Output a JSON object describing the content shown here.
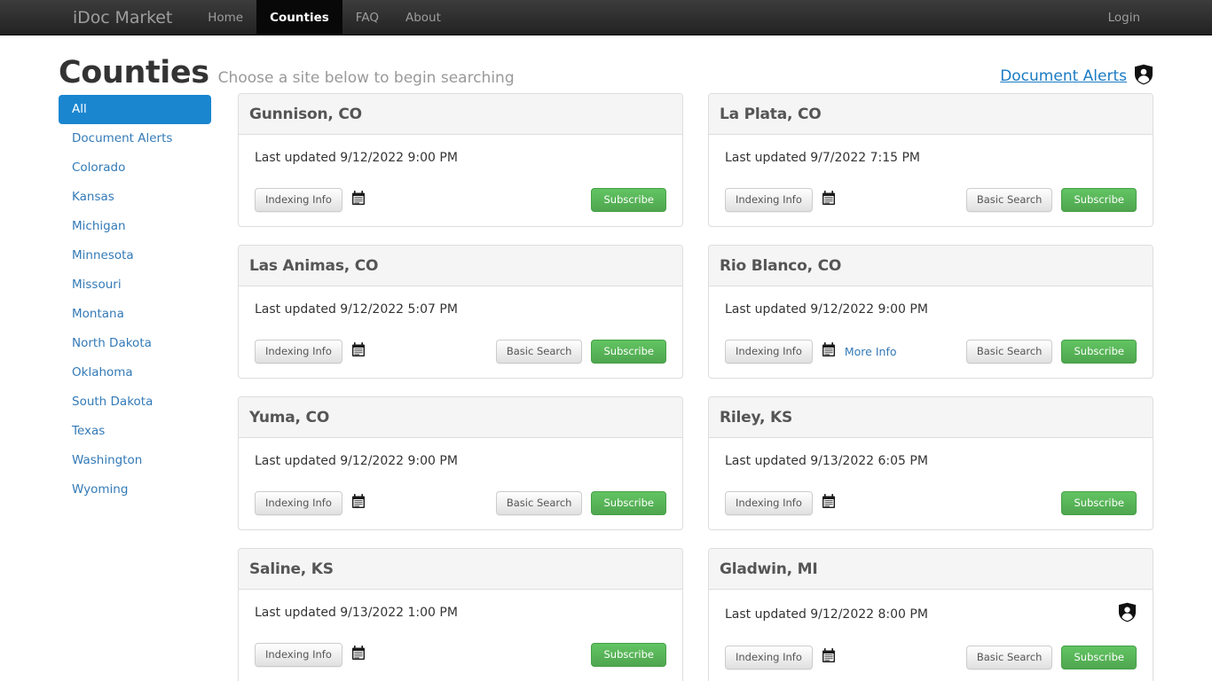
{
  "navbar": {
    "brand": "iDoc Market",
    "items": [
      {
        "label": "Home",
        "active": false
      },
      {
        "label": "Counties",
        "active": true
      },
      {
        "label": "FAQ",
        "active": false
      },
      {
        "label": "About",
        "active": false
      }
    ],
    "login_label": "Login"
  },
  "header": {
    "title": "Counties",
    "subtitle": "Choose a site below to begin searching",
    "alerts_label": "Document Alerts",
    "alerts_icon": "user-shield-icon"
  },
  "sidebar": {
    "items": [
      {
        "label": "All",
        "active": true
      },
      {
        "label": "Document Alerts",
        "active": false
      },
      {
        "label": "Colorado",
        "active": false
      },
      {
        "label": "Kansas",
        "active": false
      },
      {
        "label": "Michigan",
        "active": false
      },
      {
        "label": "Minnesota",
        "active": false
      },
      {
        "label": "Missouri",
        "active": false
      },
      {
        "label": "Montana",
        "active": false
      },
      {
        "label": "North Dakota",
        "active": false
      },
      {
        "label": "Oklahoma",
        "active": false
      },
      {
        "label": "South Dakota",
        "active": false
      },
      {
        "label": "Texas",
        "active": false
      },
      {
        "label": "Washington",
        "active": false
      },
      {
        "label": "Wyoming",
        "active": false
      }
    ]
  },
  "labels": {
    "indexing_info": "Indexing Info",
    "basic_search": "Basic Search",
    "subscribe": "Subscribe",
    "more_info": "More Info",
    "calendar_icon": "calendar-icon",
    "shield_icon": "user-shield-icon"
  },
  "colors": {
    "navbar_bg": "#222222",
    "nav_active_bg": "#080808",
    "sidebar_active_bg": "#1a86d0",
    "link_blue": "#337ab7",
    "alerts_blue": "#1a7bc4",
    "subscribe_green": "#4fa64f",
    "card_head_bg": "#f5f5f5",
    "card_border": "#dddddd"
  },
  "cards": [
    {
      "title": "Gunnison, CO",
      "last_updated": "Last updated 9/12/2022 9:00 PM",
      "has_calendar": true,
      "has_more_info": false,
      "has_basic_search": false,
      "has_subscribe": true,
      "has_row_shield": false
    },
    {
      "title": "La Plata, CO",
      "last_updated": "Last updated 9/7/2022 7:15 PM",
      "has_calendar": true,
      "has_more_info": false,
      "has_basic_search": true,
      "has_subscribe": true,
      "has_row_shield": false
    },
    {
      "title": "Las Animas, CO",
      "last_updated": "Last updated 9/12/2022 5:07 PM",
      "has_calendar": true,
      "has_more_info": false,
      "has_basic_search": true,
      "has_subscribe": true,
      "has_row_shield": false
    },
    {
      "title": "Rio Blanco, CO",
      "last_updated": "Last updated 9/12/2022 9:00 PM",
      "has_calendar": true,
      "has_more_info": true,
      "has_basic_search": true,
      "has_subscribe": true,
      "has_row_shield": false
    },
    {
      "title": "Yuma, CO",
      "last_updated": "Last updated 9/12/2022 9:00 PM",
      "has_calendar": true,
      "has_more_info": false,
      "has_basic_search": true,
      "has_subscribe": true,
      "has_row_shield": false
    },
    {
      "title": "Riley, KS",
      "last_updated": "Last updated 9/13/2022 6:05 PM",
      "has_calendar": true,
      "has_more_info": false,
      "has_basic_search": false,
      "has_subscribe": true,
      "has_row_shield": false
    },
    {
      "title": "Saline, KS",
      "last_updated": "Last updated 9/13/2022 1:00 PM",
      "has_calendar": true,
      "has_more_info": false,
      "has_basic_search": false,
      "has_subscribe": true,
      "has_row_shield": false
    },
    {
      "title": "Gladwin, MI",
      "last_updated": "Last updated 9/12/2022 8:00 PM",
      "has_calendar": true,
      "has_more_info": false,
      "has_basic_search": true,
      "has_subscribe": true,
      "has_row_shield": true
    }
  ]
}
